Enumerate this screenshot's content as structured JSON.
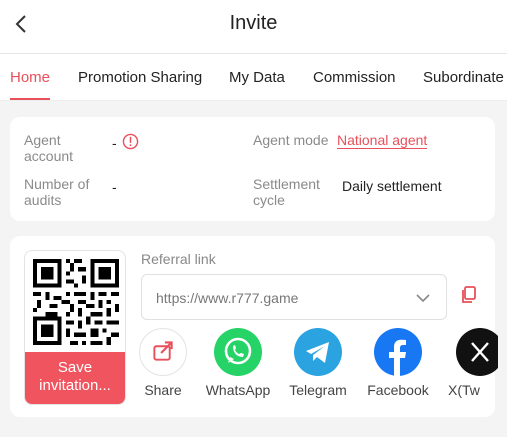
{
  "header": {
    "title": "Invite"
  },
  "tabs": [
    {
      "label": "Home"
    },
    {
      "label": "Promotion Sharing"
    },
    {
      "label": "My Data"
    },
    {
      "label": "Commission"
    },
    {
      "label": "Subordinate"
    }
  ],
  "agent_info": {
    "agent_account_label": "Agent account",
    "agent_account_value": "-",
    "agent_mode_label": "Agent mode",
    "agent_mode_value": "National agent",
    "audits_label": "Number of audits",
    "audits_value": "-",
    "settlement_label": "Settlement cycle",
    "settlement_value": "Daily settlement"
  },
  "referral": {
    "label": "Referral link",
    "url": "https://www.r777.game",
    "save_label": "Save invitation..."
  },
  "share": [
    {
      "label": "Share",
      "icon": "share-icon"
    },
    {
      "label": "WhatsApp",
      "icon": "whatsapp-icon"
    },
    {
      "label": "Telegram",
      "icon": "telegram-icon"
    },
    {
      "label": "Facebook",
      "icon": "facebook-icon"
    },
    {
      "label": "X(Tw",
      "icon": "x-icon"
    }
  ],
  "colors": {
    "accent": "#e8505b",
    "whatsapp": "#25d366",
    "telegram": "#2aa3e0",
    "facebook": "#1877f2",
    "x": "#111111"
  }
}
